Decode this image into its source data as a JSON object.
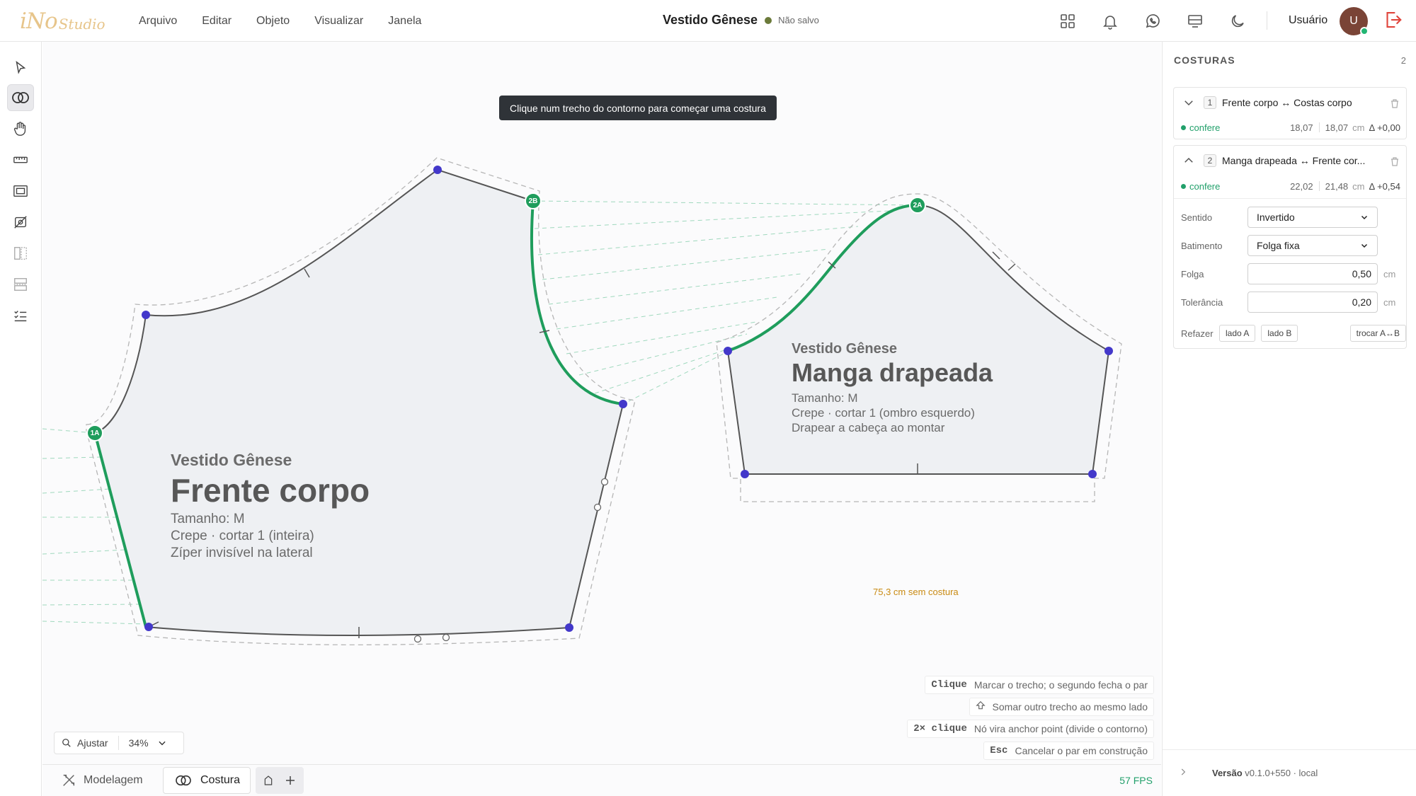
{
  "app": {
    "logo_mark": "iNo",
    "logo_sub": "Studio",
    "menu": [
      "Arquivo",
      "Editar",
      "Objeto",
      "Visualizar",
      "Janela"
    ],
    "doc_title": "Vestido Gênese",
    "save_status": "Não salvo",
    "user_label": "Usuário",
    "avatar_initial": "U"
  },
  "canvas": {
    "hint": "Clique num trecho do contorno para começar uma costura",
    "pieces": [
      {
        "model": "Vestido Gênese",
        "name": "Frente corpo",
        "size": "Tamanho: M",
        "fabric": "Crepe · cortar 1 (inteira)",
        "note": "Zíper invisível na lateral"
      },
      {
        "model": "Vestido Gênese",
        "name": "Manga drapeada",
        "size": "Tamanho: M",
        "fabric": "Crepe · cortar 1 (ombro esquerdo)",
        "note": "Drapear a cabeça ao montar"
      }
    ],
    "markers": {
      "m1a": "1A",
      "m2a": "2A",
      "m2b": "2B"
    },
    "unsewn_label": "75,3 cm sem costura",
    "shortcuts": [
      {
        "key": "Clique",
        "desc": "Marcar o trecho; o segundo fecha o par"
      },
      {
        "key": "",
        "desc": "Somar outro trecho ao mesmo lado",
        "icon": "shift-icon"
      },
      {
        "key": "2× clique",
        "desc": "Nó vira anchor point (divide o contorno)"
      },
      {
        "key": "Esc",
        "desc": "Cancelar o par em construção"
      }
    ],
    "zoom": {
      "fit_label": "Ajustar",
      "level": "34%"
    }
  },
  "bottom": {
    "tabs": [
      "Modelagem",
      "Costura"
    ],
    "fps": "57 FPS"
  },
  "panel": {
    "title": "COSTURAS",
    "count": "2",
    "seams": [
      {
        "index": "1",
        "pair": "Frente corpo ↔ Costas corpo",
        "status": "confere",
        "len_a": "18,07",
        "len_b": "18,07",
        "unit": "cm",
        "delta": "Δ +0,00"
      },
      {
        "index": "2",
        "pair": "Manga drapeada ↔ Frente cor...",
        "status": "confere",
        "len_a": "22,02",
        "len_b": "21,48",
        "unit": "cm",
        "delta": "Δ +0,54",
        "fields": {
          "sentido_label": "Sentido",
          "sentido_value": "Invertido",
          "batimento_label": "Batimento",
          "batimento_value": "Folga fixa",
          "folga_label": "Folga",
          "folga_value": "0,50",
          "tolerancia_label": "Tolerância",
          "tolerancia_value": "0,20",
          "unit": "cm",
          "refazer_label": "Refazer",
          "lado_a": "lado A",
          "lado_b": "lado B",
          "trocar": "trocar A↔B"
        }
      }
    ],
    "version_label": "Versão",
    "version_value": "v0.1.0+550 · local"
  },
  "colors": {
    "seam_green": "#1f9d5c",
    "node_blue": "#4338ca",
    "accent_gold": "#e7c58b",
    "orange_note": "#c98a12"
  }
}
